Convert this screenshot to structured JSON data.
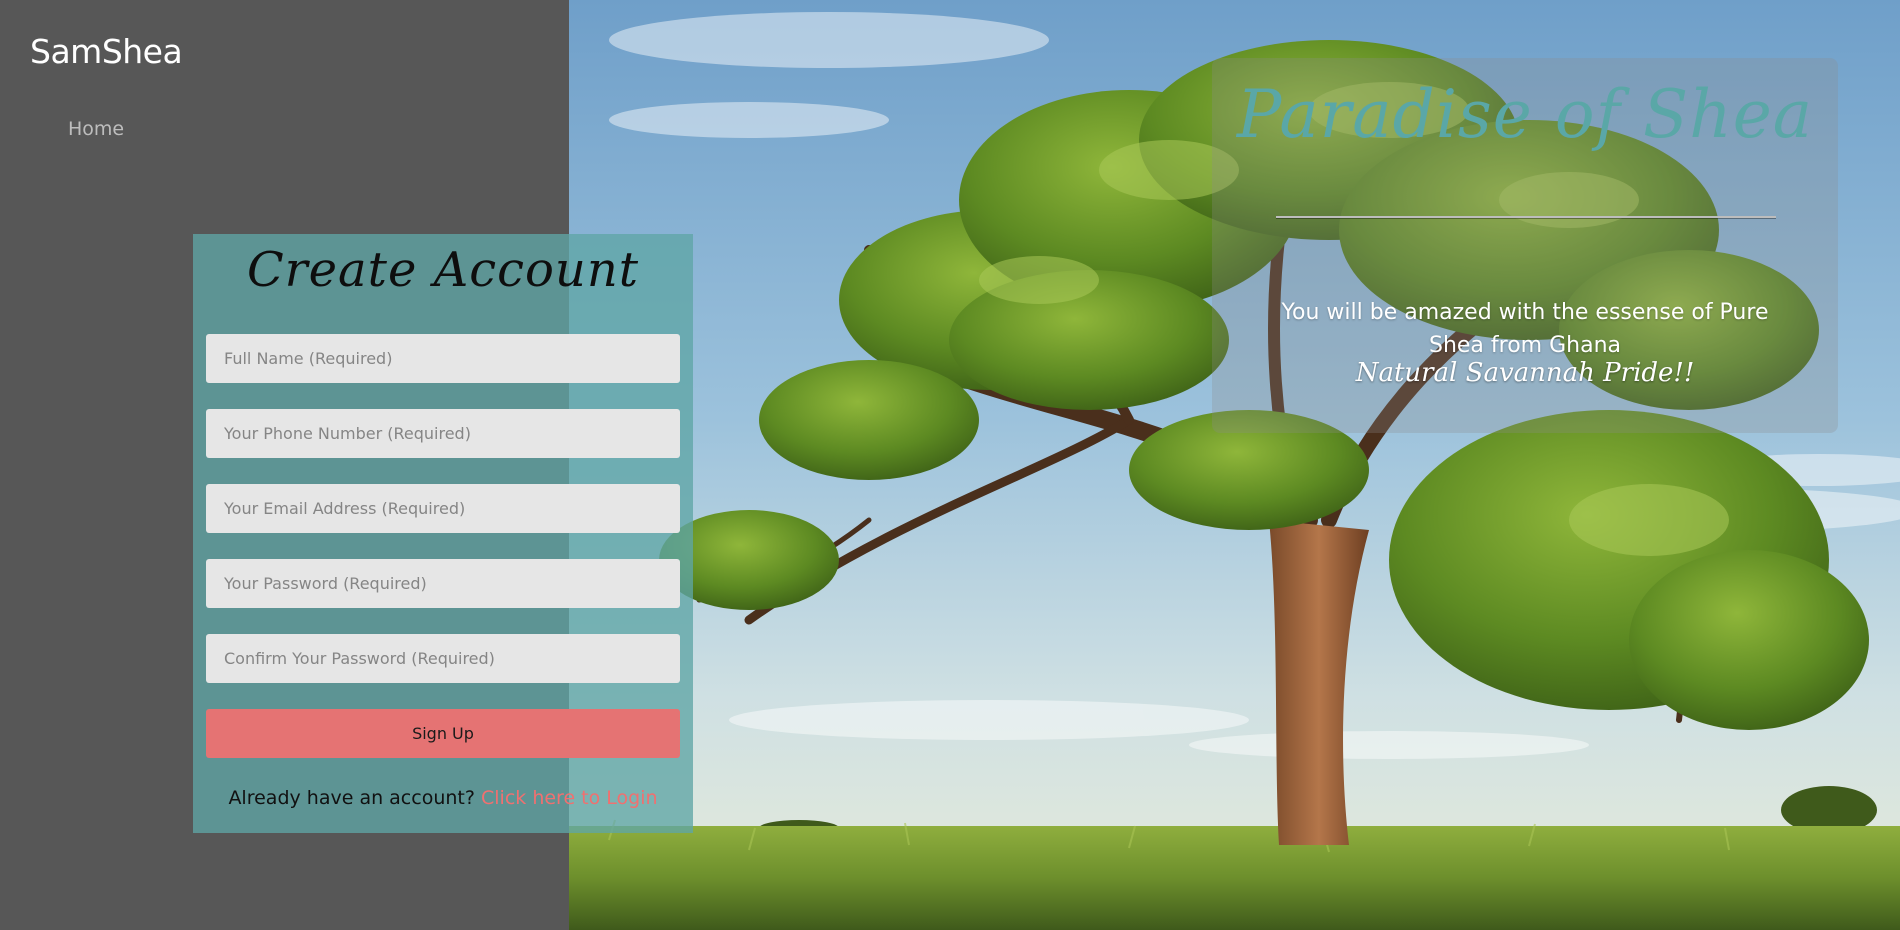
{
  "sidebar": {
    "brand": "SamShea",
    "nav": [
      {
        "label": "Home"
      }
    ]
  },
  "hero": {
    "title": "Paradise of Shea",
    "text": "You will be amazed with the essense of Pure Shea from Ghana",
    "tagline": "Natural Savannah Pride!!"
  },
  "signup": {
    "title": "Create Account",
    "fields": {
      "full_name": "Full Name (Required)",
      "phone": "Your Phone Number (Required)",
      "email": "Your Email Address (Required)",
      "password": "Your Password (Required)",
      "confirm_password": "Confirm Your Password (Required)"
    },
    "button": "Sign Up",
    "login_prompt": "Already have an account?",
    "login_link": "Click here to Login"
  },
  "colors": {
    "sidebar": "#575757",
    "panel": "#5fa5a5",
    "title_teal": "#5aa7a7",
    "button": "#e57373",
    "link": "#f07070"
  }
}
